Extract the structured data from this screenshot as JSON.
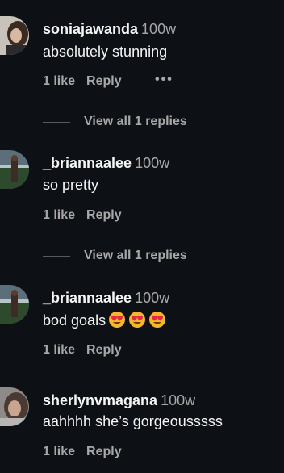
{
  "comments": [
    {
      "username": "soniajawanda",
      "time": "100w",
      "text": "absolutely stunning",
      "likes": "1 like",
      "reply": "Reply",
      "more": "•••",
      "view_replies": "View all 1 replies"
    },
    {
      "username": "_briannaalee",
      "time": "100w",
      "text": "so pretty",
      "likes": "1 like",
      "reply": "Reply",
      "view_replies": "View all 1 replies"
    },
    {
      "username": "_briannaalee",
      "time": "100w",
      "text": "bod goals",
      "emoji": [
        "heart-eyes-emoji",
        "heart-eyes-emoji",
        "heart-eyes-emoji"
      ],
      "likes": "1 like",
      "reply": "Reply"
    },
    {
      "username": "sherlynvmagana",
      "time": "100w",
      "text": "aahhhh she’s gorgeousssss",
      "likes": "1 like",
      "reply": "Reply"
    }
  ],
  "colors": {
    "background": "#0d1014",
    "primary_text": "#f5f5f5",
    "secondary_text": "#a8a8a8",
    "divider": "#555a60"
  }
}
